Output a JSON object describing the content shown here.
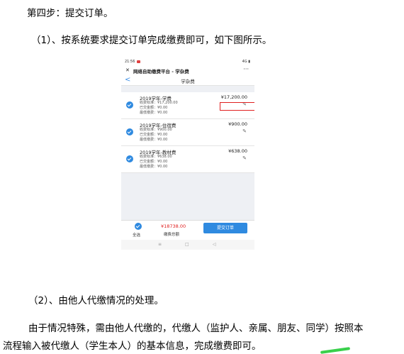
{
  "doc": {
    "step_title": "第四步：提交订单。",
    "para1": "（1）、按系统要求提交订单完成缴费即可，如下图所示。",
    "para2": "（2）、由他人代缴情况的处理。",
    "para3_line1": "由于情况特殊，需由他人代缴的，代缴人（监护人、亲属、朋友、同学）按照本",
    "para3_line2": "流程输入被代缴人（学生本人）的基本信息，完成缴费即可。"
  },
  "phone": {
    "status_time": "21:56",
    "status_right": "4G ▮",
    "app_title": "网络自助缴费平台 - 学杂费",
    "close_symbol": "✕",
    "more_symbol": "···",
    "page_title": "学杂费",
    "back_symbol": "<",
    "items": [
      {
        "name": "2019学年-学费",
        "amount": "¥17,200.00",
        "standard": "收费标准：¥17,200.00",
        "paid": "已交金额：¥0.00",
        "minimum": "最低缴费：¥0.00"
      },
      {
        "name": "2019学年-住宿费",
        "amount": "¥900.00",
        "standard": "收费标准：¥900.00",
        "paid": "已交金额：¥0.00",
        "minimum": "最低缴费：¥0.00"
      },
      {
        "name": "2019学年-教材费",
        "amount": "¥638.00",
        "standard": "收费标准：¥638.00",
        "paid": "已交金额：¥0.00",
        "minimum": "最低缴费：¥0.00"
      }
    ],
    "select_all": "全选",
    "total_amount": "¥18738.00",
    "total_label": "缴费总额",
    "submit_label": "提交订单",
    "nav_icons": [
      "≡",
      "□",
      "◁"
    ]
  },
  "colors": {
    "accent": "#2f8ae0",
    "highlight_box": "#e02020",
    "price": "#e02020"
  }
}
